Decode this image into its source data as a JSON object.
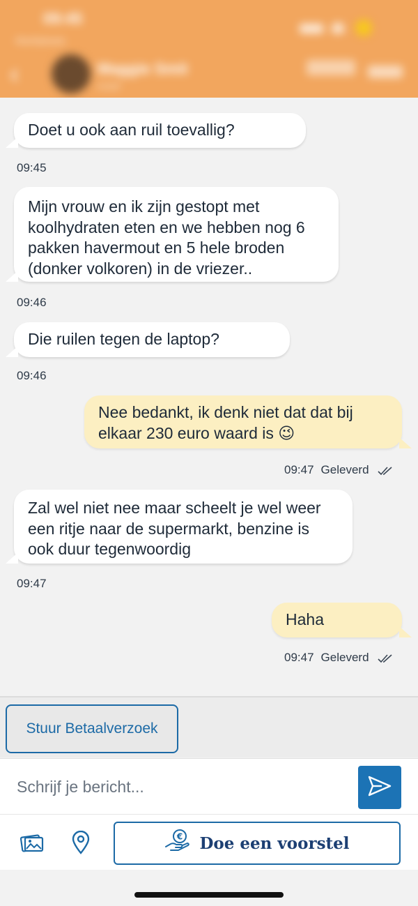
{
  "header": {
    "time": "09:45",
    "carrier": "Marktplaats",
    "contact_name": "Maggie Smit",
    "contact_sub": "Actief",
    "back_icon": "chevron-left-icon"
  },
  "messages": [
    {
      "id": "m1",
      "direction": "in",
      "text_lines": [
        "Doet u ook aan ruil toevallig?"
      ],
      "time": "09:45"
    },
    {
      "id": "m2",
      "direction": "in",
      "text_lines": [
        "Mijn vrouw en ik zijn gestopt met",
        "koolhydraten eten en we hebben nog 6",
        "pakken havermout en 5 hele broden",
        "(donker volkoren) in de vriezer.."
      ],
      "time": "09:46"
    },
    {
      "id": "m3",
      "direction": "in",
      "text_lines": [
        "Die ruilen tegen de laptop?"
      ],
      "time": "09:46"
    },
    {
      "id": "m4",
      "direction": "out",
      "text_lines": [
        "Nee bedankt, ik denk niet dat dat bij",
        "elkaar 230 euro waard is 😉"
      ],
      "time": "09:47",
      "status": "Geleverd"
    },
    {
      "id": "m5",
      "direction": "in",
      "text_lines": [
        "Zal wel niet nee maar scheelt je wel weer",
        "een ritje naar de supermarkt, benzine is",
        "ook duur tegenwoordig"
      ],
      "time": "09:47"
    },
    {
      "id": "m6",
      "direction": "out",
      "text_lines": [
        "Haha"
      ],
      "time": "09:47",
      "status": "Geleverd"
    }
  ],
  "payment_request": {
    "label": "Stuur Betaalverzoek"
  },
  "composer": {
    "placeholder": "Schrijf je bericht...",
    "send_icon": "send-icon"
  },
  "actions": {
    "photo_icon": "photo-icon",
    "location_icon": "location-pin-icon",
    "offer_label": "Doe een voorstel",
    "offer_icon": "hand-euro-icon"
  },
  "colors": {
    "header": "#f2a65e",
    "incoming_bubble": "#ffffff",
    "outgoing_bubble": "#fcefc2",
    "accent_blue": "#1c6aa6",
    "send_button": "#1c73b5",
    "background": "#f2f2f2"
  }
}
